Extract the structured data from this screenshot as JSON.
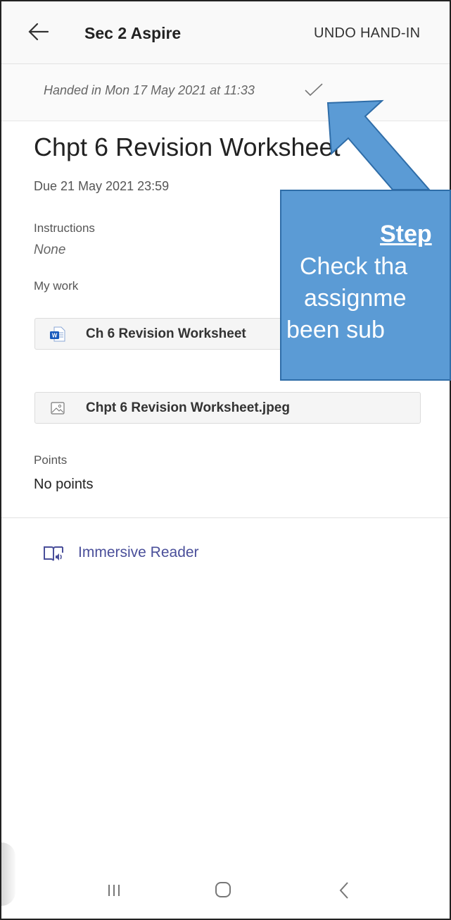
{
  "header": {
    "title": "Sec 2 Aspire",
    "action_label": "UNDO HAND-IN"
  },
  "status": {
    "handed_in": "Handed in Mon 17 May 2021 at 11:33"
  },
  "assignment": {
    "title": "Chpt 6 Revision Worksheet",
    "due": "Due 21 May 2021 23:59",
    "instructions_label": "Instructions",
    "instructions_value": "None",
    "my_work_label": "My work",
    "files": [
      {
        "name": "Ch 6 Revision Worksheet",
        "icon": "word-doc-icon"
      },
      {
        "name": "Chpt 6 Revision Worksheet.jpeg",
        "icon": "image-file-icon"
      }
    ],
    "points_label": "Points",
    "points_value": "No points"
  },
  "immersive_reader": {
    "label": "Immersive Reader"
  },
  "annotation": {
    "step": "Step",
    "line1": "Check tha",
    "line2": "assignme",
    "line3": "been sub"
  },
  "colors": {
    "accent": "#4a4f9a",
    "callout": "#5b9bd5",
    "word_blue": "#185abd"
  }
}
